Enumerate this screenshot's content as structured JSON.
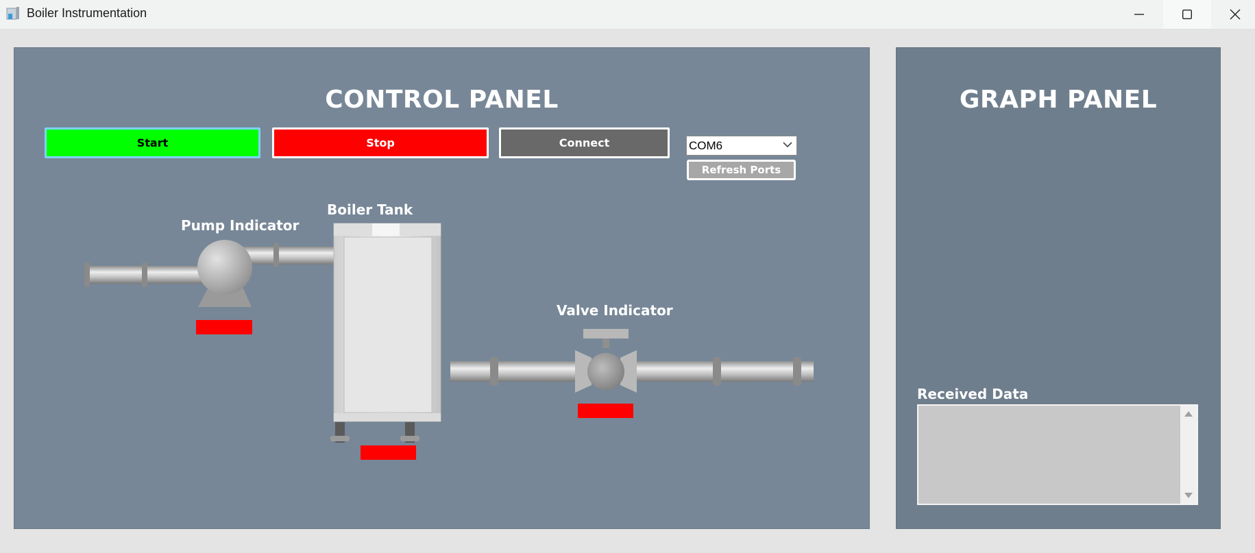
{
  "window": {
    "title": "Boiler Instrumentation",
    "controls": [
      "minimize-icon",
      "maximize-icon",
      "close-icon"
    ]
  },
  "control_panel": {
    "title": "CONTROL PANEL",
    "buttons": {
      "start": "Start",
      "stop": "Stop",
      "connect": "Connect"
    },
    "port": {
      "selected": "COM6",
      "refresh_label": "Refresh Ports"
    },
    "labels": {
      "pump": "Pump Indicator",
      "boiler": "Boiler Tank",
      "valve": "Valve Indicator"
    },
    "indicator_color": "#ff0000"
  },
  "graph_panel": {
    "title": "GRAPH PANEL",
    "received_label": "Received Data",
    "received_text": ""
  },
  "colors": {
    "start": "#00ff00",
    "stop": "#ff0000",
    "connect": "#696969",
    "control_bg": "#778797",
    "graph_bg": "#6f7e8d"
  }
}
